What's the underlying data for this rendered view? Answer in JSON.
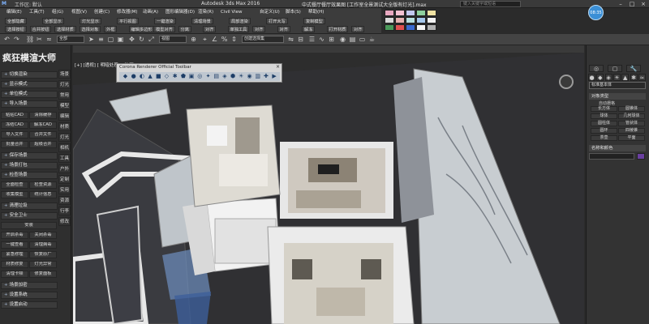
{
  "window": {
    "workspace_label": "工作区: 默认",
    "app_title": "Autodesk 3ds Max 2016",
    "file_title": "中式餐厅餐厅效果图 [工作室全景测试大全版有灯光].max",
    "search_placeholder": "键入关键字或短语",
    "avatar_text": "08:35"
  },
  "menu": [
    "编辑(E)",
    "工具(T)",
    "组(G)",
    "视图(V)",
    "创建(C)",
    "修改器(M)",
    "动画(A)",
    "图形编辑器(D)",
    "渲染(R)",
    "Civil View",
    "自定义(U)",
    "脚本(S)",
    "帮助(H)"
  ],
  "plugin_toolbar": {
    "row1": [
      "全部隐藏",
      "全部显示",
      "灯光显示",
      "平行视图",
      "一键渲染",
      "清理场景",
      "局部渲染",
      "打开大写",
      "复制模型"
    ],
    "row2": [
      "选择按钮",
      "合并按钮",
      "选择材质",
      "选择对象",
      "外框",
      "编辑多边形",
      "模型对齐",
      "分离",
      "对齐",
      "单独工具",
      "对齐",
      "对齐",
      "解冻",
      "打开材质",
      "对齐"
    ],
    "palette": [
      "#e8a8c0",
      "#f4c2d2",
      "#c3c8f0",
      "#8fd19e",
      "#f0e3a3",
      "#d9d9d9",
      "#e5b3b3",
      "#b8e0e0",
      "#a6c8ec",
      "#f2f2f2",
      "#4a9a5a",
      "#e05050",
      "#3a6ad0",
      "#f5f5f5",
      "#b0b0b0"
    ]
  },
  "main_toolbar": {
    "filter_value": "全部",
    "view_value": "视图",
    "selection_set": "创建选择集"
  },
  "viewport_label": "[+] [透视] [ 明暗处理 + 边面 ]",
  "corona_toolbar_title": "Corona Renderer Official Toolbar",
  "left_panel": {
    "title": "疯狂模渲大师",
    "side_tabs": [
      "场景",
      "灯光",
      "常用",
      "模型",
      "编辑",
      "材质",
      "灯光",
      "相机",
      "工具",
      "户外",
      "定制",
      "实用",
      "资源",
      "行李",
      "修改"
    ],
    "sections": [
      {
        "label": "切换渲染"
      },
      {
        "label": "显示模式"
      },
      {
        "label": "单位模式"
      },
      {
        "label": "导入场景"
      }
    ],
    "grid1": [
      [
        "粘贴CAD",
        "清除缓存"
      ],
      [
        "冻结CAD",
        "解冻CAD"
      ],
      [
        "导入文件",
        "合并文件"
      ],
      [
        "批量合并",
        "超级合并"
      ]
    ],
    "sections2": [
      {
        "label": "保存场景"
      },
      {
        "label": "场景打包"
      },
      {
        "label": "检查场景"
      }
    ],
    "grid2": [
      [
        "全面检查",
        "检查资源"
      ],
      [
        "收集模型",
        "统计信息"
      ]
    ],
    "sections3": [
      {
        "label": "清理垃圾"
      },
      {
        "label": "安全卫士"
      }
    ],
    "sub_header": "安装",
    "grid3": [
      [
        "开启杀毒",
        "关闭杀毒"
      ],
      [
        "一键查看",
        "清理病毒"
      ],
      [
        "紧急修理",
        "恢复原厂"
      ],
      [
        "材质修复",
        "灯光异常"
      ],
      [
        "清理卡顿",
        "修复面板"
      ]
    ],
    "sections4": [
      {
        "label": "场景加密"
      },
      {
        "label": "设置系统"
      },
      {
        "label": "设置启动"
      }
    ]
  },
  "right_panel": {
    "dropdown": "标准基本体",
    "object_type": "对象类型",
    "autogrid": "自动栅格",
    "objects": [
      [
        "长方体",
        "圆锥体"
      ],
      [
        "球体",
        "几何球体"
      ],
      [
        "圆柱体",
        "管状体"
      ],
      [
        "圆环",
        "四棱锥"
      ],
      [
        "茶壶",
        "平面"
      ]
    ],
    "name_color": "名称和颜色"
  }
}
